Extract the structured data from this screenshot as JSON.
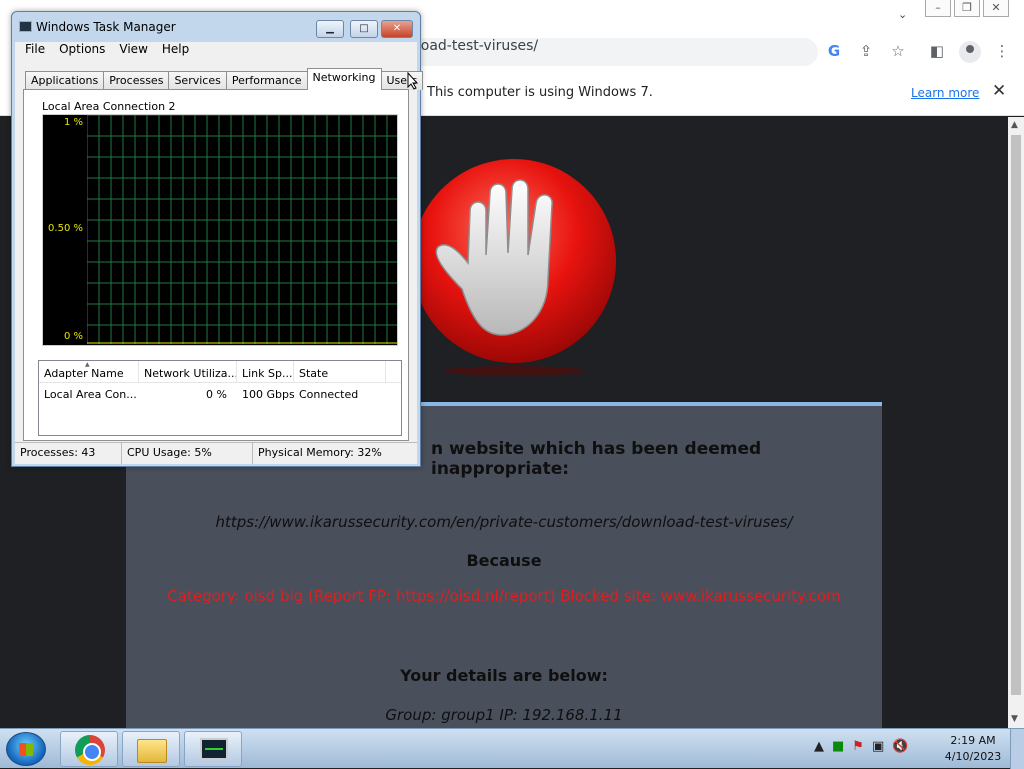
{
  "browser": {
    "url_partial": "nload-test-viruses/",
    "info_message": "This computer is using Windows 7.",
    "learn_more": "Learn more"
  },
  "page": {
    "notice": "n website which has been deemed inappropriate:",
    "blocked_url": "https://www.ikarussecurity.com/en/private-customers/download-test-viruses/",
    "because": "Because",
    "reason": "Category: oisd big (Report FP: https://oisd.nl/report)   Blocked site: www.ikarussecurity.com",
    "details_heading": "Your details are below:",
    "details": "Group: group1   IP: 192.168.1.11"
  },
  "taskmgr": {
    "title": "Windows Task Manager",
    "menu": [
      "File",
      "Options",
      "View",
      "Help"
    ],
    "tabs": [
      "Applications",
      "Processes",
      "Services",
      "Performance",
      "Networking",
      "Users"
    ],
    "active_tab": "Networking",
    "connection": "Local Area Connection 2",
    "graph_labels": [
      "1 %",
      "0.50 %",
      "0 %"
    ],
    "columns": [
      "Adapter Name",
      "Network Utiliza...",
      "Link Sp...",
      "State"
    ],
    "rows": [
      {
        "name": "Local Area Con...",
        "util": "0 %",
        "speed": "100 Gbps",
        "state": "Connected"
      }
    ],
    "status": {
      "processes": "Processes: 43",
      "cpu": "CPU Usage: 5%",
      "memory": "Physical Memory: 32%"
    }
  },
  "clock": {
    "time": "2:19 AM",
    "date": "4/10/2023"
  },
  "colors": {
    "graph_grid": "#1f7a45",
    "blocked_red": "#e01e1e",
    "panel": "#4a4f5c"
  }
}
